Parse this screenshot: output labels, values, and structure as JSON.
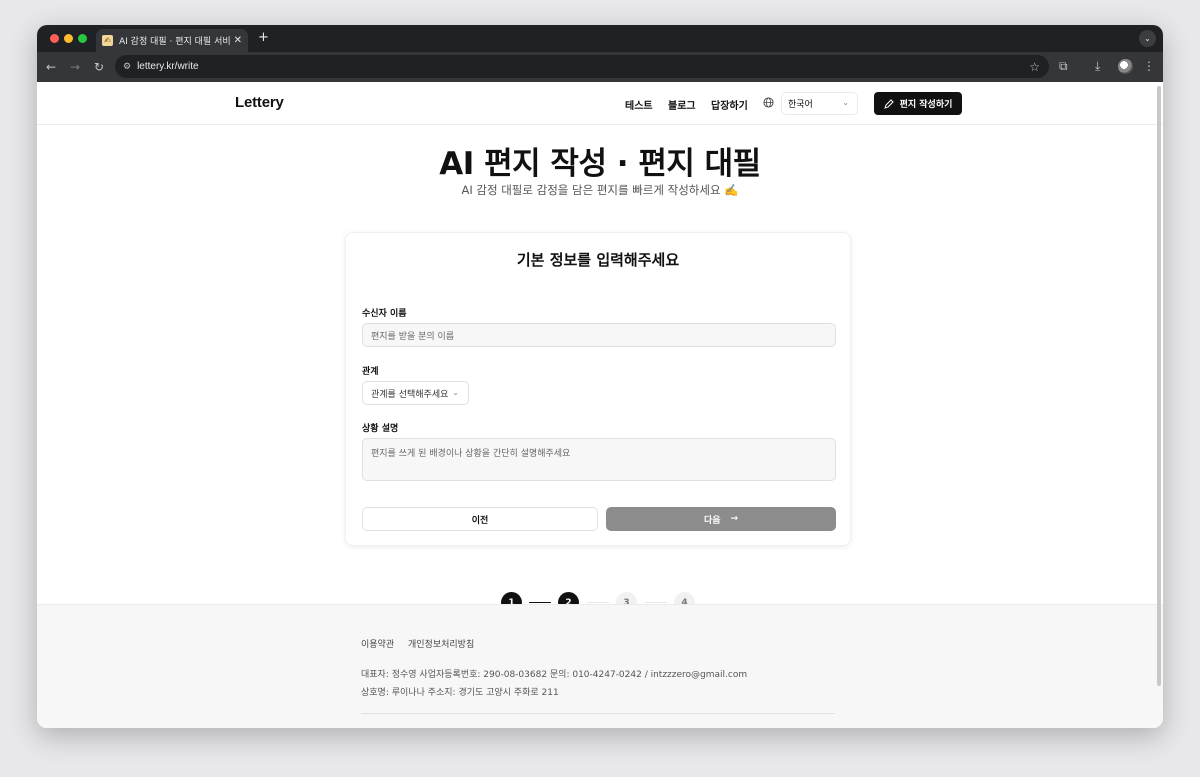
{
  "browser": {
    "tab_title": "AI 감정 대필 · 편지 대필 서비스 - L",
    "tab_favicon": "✍",
    "url": "lettery.kr/write"
  },
  "header": {
    "logo": "Lettery",
    "nav": [
      "테스트",
      "블로그",
      "답장하기"
    ],
    "language": "한국어",
    "write_button": "편지 작성하기"
  },
  "hero": {
    "title": "AI 편지 작성 · 편지 대필",
    "subtitle": "AI 감정 대필로 감정을 담은 편지를 빠르게 작성하세요 ✍️"
  },
  "form": {
    "title": "기본 정보를 입력해주세요",
    "recipient_label": "수신자 이름",
    "recipient_placeholder": "편지를 받을 분의 이름",
    "relation_label": "관계",
    "relation_selected": "관계를 선택해주세요",
    "situation_label": "상황 설명",
    "situation_placeholder": "편지를 쓰게 된 배경이나 상황을 간단히 설명해주세요",
    "prev_button": "이전",
    "next_button": "다음"
  },
  "steps": {
    "labels": [
      "1",
      "2",
      "3",
      "4"
    ],
    "current": 2
  },
  "footer": {
    "terms": "이용약관",
    "privacy": "개인정보처리방침",
    "line1": "대표자: 정수영   사업자등록번호: 290-08-03682   문의: 010-4247-0242 / intzzzero@gmail.com",
    "line2": "상호명: 루이나나   주소지: 경기도 고양시 주화로 211"
  },
  "colors": {
    "primary": "#111111",
    "disabled_button": "#8c8c8c",
    "step_todo": "#f1f1f1"
  }
}
